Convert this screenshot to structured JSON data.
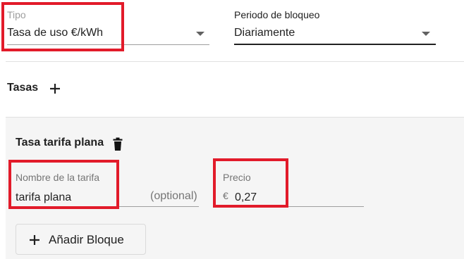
{
  "tipo": {
    "label": "Tipo",
    "value": "Tasa de uso €/kWh",
    "icon": "dropdown-caret-icon"
  },
  "periodo": {
    "label": "Periodo de bloqueo",
    "value": "Diariamente",
    "icon": "dropdown-caret-icon"
  },
  "tasas": {
    "title": "Tasas",
    "add_icon": "plus-icon"
  },
  "rate": {
    "title": "Tasa tarifa plana",
    "delete_icon": "trash-icon",
    "name_field": {
      "label": "Nombre de la tarifa",
      "value": "tarifa plana",
      "hint": "(optional)"
    },
    "price_field": {
      "label": "Precio",
      "prefix": "€",
      "value": "0,27"
    },
    "add_block_button": {
      "icon": "plus-icon",
      "label": "Añadir Bloque"
    }
  },
  "colors": {
    "highlight": "#e21b2a",
    "panel_bg": "#f5f5f5",
    "label_gray": "#757575",
    "dropdown_label": "#9e9e9e"
  }
}
